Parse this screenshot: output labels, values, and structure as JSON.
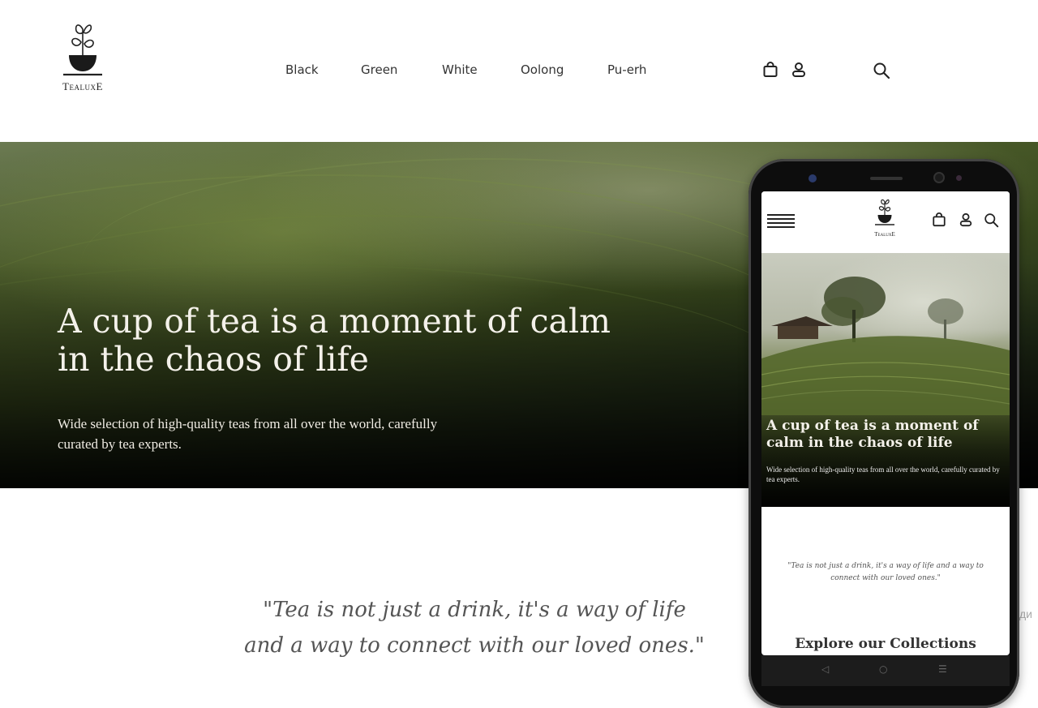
{
  "brand": {
    "name": "TealuxE",
    "icon": "tea-cup-logo"
  },
  "nav": {
    "items": [
      {
        "label": "Black"
      },
      {
        "label": "Green"
      },
      {
        "label": "White"
      },
      {
        "label": "Oolong"
      },
      {
        "label": "Pu-erh"
      }
    ]
  },
  "header_icons": [
    "shopping-bag-icon",
    "user-icon",
    "search-icon"
  ],
  "hero": {
    "title": "A cup of tea is a moment of calm in the chaos of life",
    "subtitle": "Wide selection of high-quality teas from all over the world, carefully curated by tea experts."
  },
  "quote": {
    "text": "\"Tea is not just a drink, it's a way of life and a way to connect with our loved ones.\""
  },
  "edge_text": "ди",
  "mobile": {
    "brand": "TealuxE",
    "hero_title": "A cup of tea is a moment of calm in the chaos of life",
    "hero_subtitle": "Wide selection of high-quality teas from all over the world, carefully curated by tea experts.",
    "quote": "\"Tea is not just a drink, it's a way of life and a way to connect with our loved ones.\"",
    "section_heading": "Explore our Collections",
    "navbar": {
      "back": "◁",
      "home": "○",
      "menu": "☰"
    }
  },
  "colors": {
    "text_dark": "#333333",
    "hero_text": "#f4f1ea",
    "quote_text": "#555555",
    "phone_body": "#0d0d0d"
  }
}
